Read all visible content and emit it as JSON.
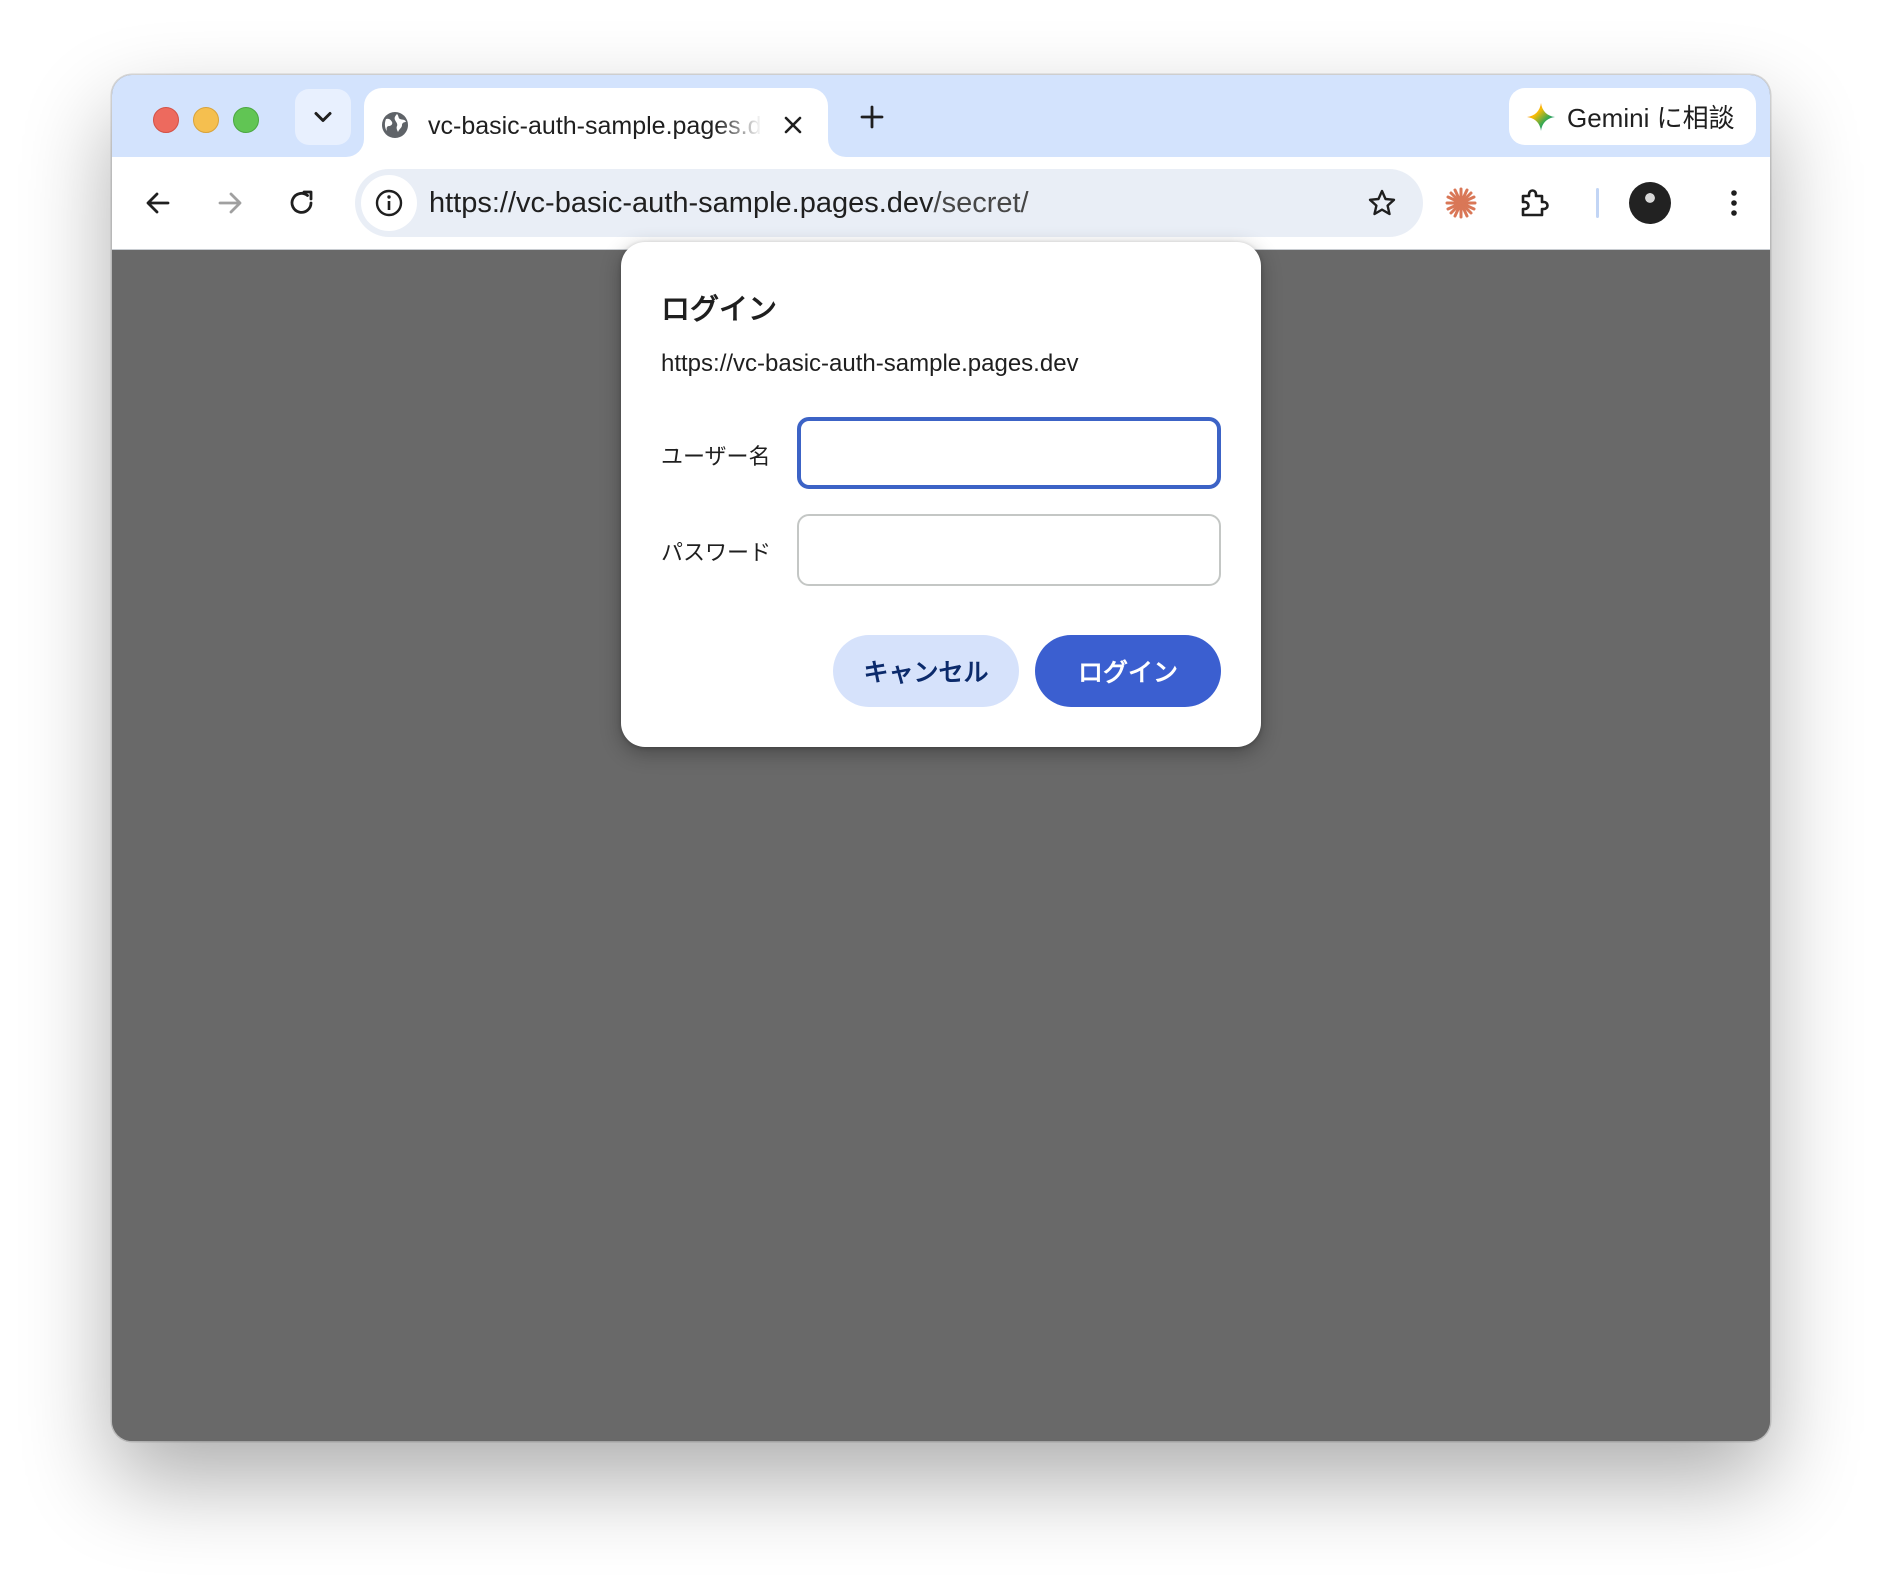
{
  "tab": {
    "title": "vc-basic-auth-sample.pages.dev"
  },
  "gemini": {
    "label": "Gemini に相談"
  },
  "omnibox": {
    "url_host": "https://vc-basic-auth-sample.pages.dev",
    "url_path": "/secret/"
  },
  "dialog": {
    "title": "ログイン",
    "origin": "https://vc-basic-auth-sample.pages.dev",
    "username_label": "ユーザー名",
    "username_value": "",
    "password_label": "パスワード",
    "password_value": "",
    "cancel_label": "キャンセル",
    "login_label": "ログイン"
  },
  "icons": {
    "tab_search": "chevron-down-icon",
    "favicon": "globe-icon",
    "close": "close-icon",
    "new_tab": "plus-icon",
    "gemini": "gemini-sparkle-icon",
    "back": "arrow-left-icon",
    "forward": "arrow-right-icon",
    "reload": "reload-icon",
    "site_info": "info-icon",
    "bookmark": "star-icon",
    "extension_claude": "claude-starburst-icon",
    "extensions": "puzzle-icon",
    "menu": "more-vertical-icon"
  },
  "colors": {
    "tabbar": "#d3e3fd",
    "omnibox": "#e9eef6",
    "page_background": "#696969",
    "accent": "#3b5fd0",
    "cancel_button": "#d6e2fb",
    "claude_icon": "#d97757"
  }
}
